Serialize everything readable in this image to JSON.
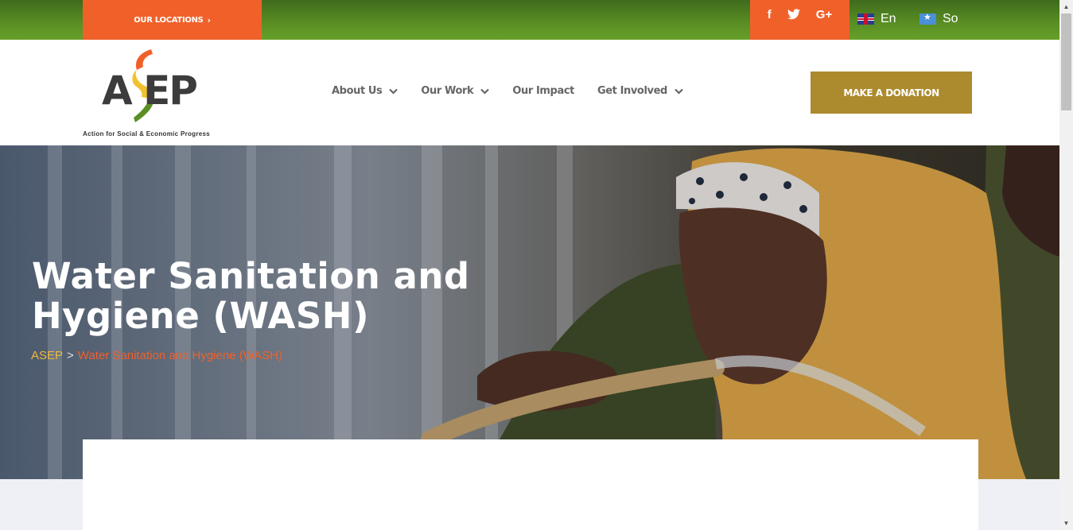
{
  "topbar": {
    "locations_label": "OUR LOCATIONS",
    "locations_chevron": "›",
    "social": {
      "facebook": "f",
      "twitter": "t",
      "googleplus": "G+"
    },
    "languages": [
      {
        "flag": "uk-flag-icon",
        "label": "En"
      },
      {
        "flag": "somalia-flag-icon",
        "label": "So"
      }
    ]
  },
  "logo": {
    "mark": "A EP",
    "tagline": "Action for Social & Economic Progress",
    "colors": {
      "orange": "#f0612a",
      "yellow": "#f2c12e",
      "green": "#5a8f24",
      "dark": "#3c3c3c"
    }
  },
  "nav": {
    "items": [
      {
        "label": "About Us",
        "has_dropdown": true
      },
      {
        "label": "Our Work",
        "has_dropdown": true
      },
      {
        "label": "Our Impact",
        "has_dropdown": false
      },
      {
        "label": "Get Involved",
        "has_dropdown": true
      }
    ],
    "donate_label": "MAKE A DONATION"
  },
  "hero": {
    "title": "Water Sanitation and Hygiene (WASH)",
    "breadcrumb": {
      "home": "ASEP",
      "separator": ">",
      "current": "Water Sanitation and Hygiene (WASH)"
    }
  },
  "colors": {
    "accent_orange": "#f0612a",
    "green": "#5a8f24",
    "gold": "#ac8a2e",
    "breadcrumb_home": "#f0b93a"
  }
}
